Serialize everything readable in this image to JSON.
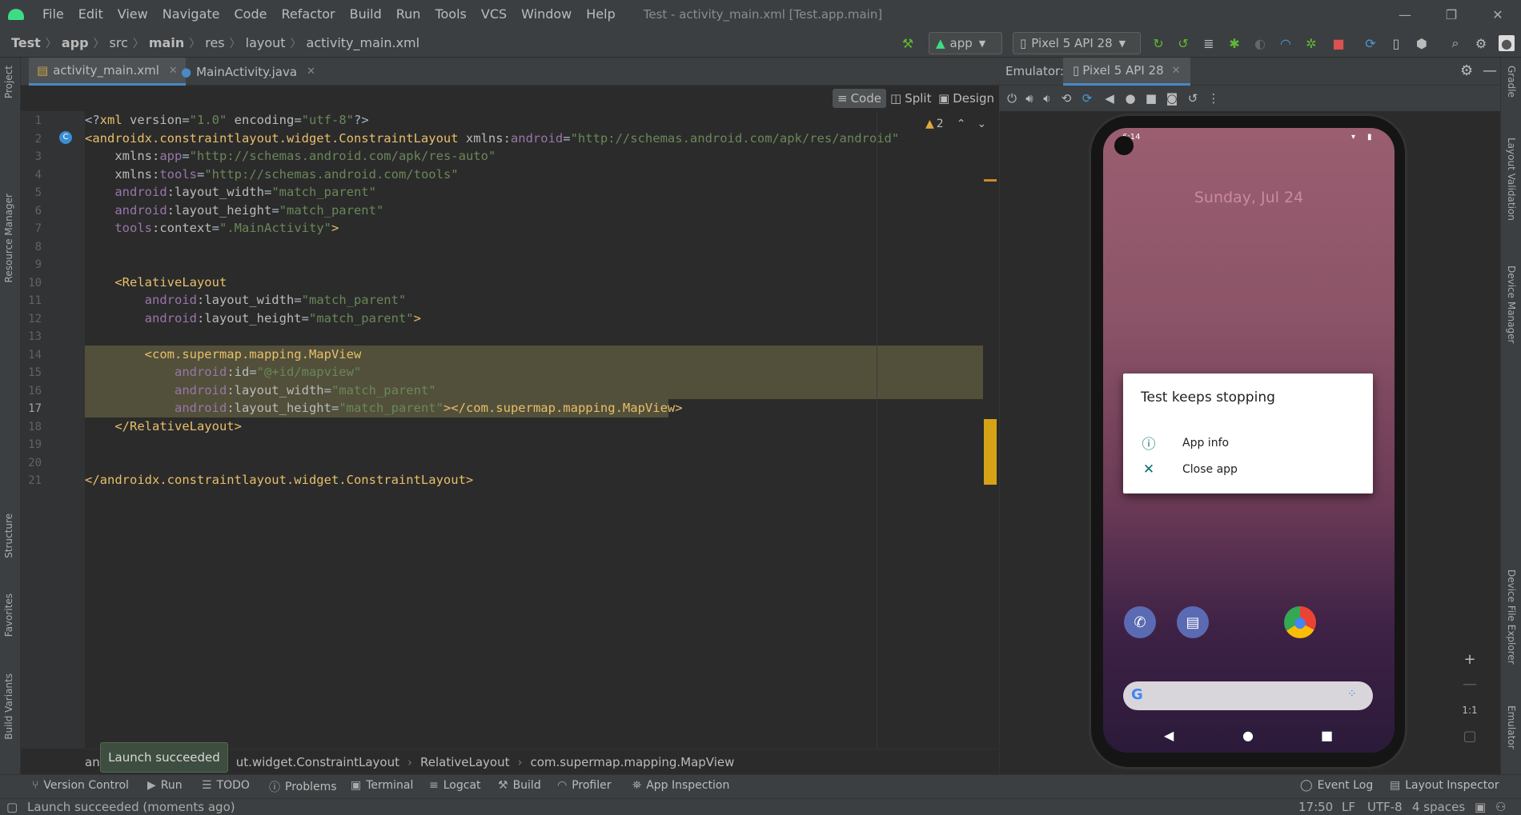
{
  "menu": {
    "items": [
      "File",
      "Edit",
      "View",
      "Navigate",
      "Code",
      "Refactor",
      "Build",
      "Run",
      "Tools",
      "VCS",
      "Window",
      "Help"
    ],
    "window_title": "Test - activity_main.xml [Test.app.main]"
  },
  "breadcrumb": {
    "items": [
      "Test",
      "app",
      "src",
      "main",
      "res",
      "layout",
      "activity_main.xml"
    ]
  },
  "toolbar": {
    "run_config": "app",
    "device": "Pixel 5 API 28"
  },
  "tabs": [
    {
      "label": "activity_main.xml"
    },
    {
      "label": "MainActivity.java"
    }
  ],
  "view_modes": {
    "code": "Code",
    "split": "Split",
    "design": "Design"
  },
  "inspections": {
    "warnings": "2"
  },
  "editor": {
    "lines": [
      [
        {
          "c": "p",
          "t": "<?"
        },
        {
          "c": "t",
          "t": "xml "
        },
        {
          "c": "a",
          "t": "version"
        },
        {
          "c": "p",
          "t": "="
        },
        {
          "c": "v",
          "t": "\"1.0\""
        },
        {
          "c": "a",
          "t": " encoding"
        },
        {
          "c": "p",
          "t": "="
        },
        {
          "c": "v",
          "t": "\"utf-8\""
        },
        {
          "c": "p",
          "t": "?>"
        }
      ],
      [
        {
          "c": "t",
          "t": "<androidx.constraintlayout.widget.ConstraintLayout "
        },
        {
          "c": "a",
          "t": "xmlns:"
        },
        {
          "c": "n",
          "t": "android"
        },
        {
          "c": "p",
          "t": "="
        },
        {
          "c": "v",
          "t": "\"http://schemas.android.com/apk/res/android\""
        }
      ],
      [
        {
          "c": "a",
          "t": "    xmlns:"
        },
        {
          "c": "n",
          "t": "app"
        },
        {
          "c": "p",
          "t": "="
        },
        {
          "c": "v",
          "t": "\"http://schemas.android.com/apk/res-auto\""
        }
      ],
      [
        {
          "c": "a",
          "t": "    xmlns:"
        },
        {
          "c": "n",
          "t": "tools"
        },
        {
          "c": "p",
          "t": "="
        },
        {
          "c": "v",
          "t": "\"http://schemas.android.com/tools\""
        }
      ],
      [
        {
          "c": "n",
          "t": "    android"
        },
        {
          "c": "a",
          "t": ":layout_width"
        },
        {
          "c": "p",
          "t": "="
        },
        {
          "c": "v",
          "t": "\"match_parent\""
        }
      ],
      [
        {
          "c": "n",
          "t": "    android"
        },
        {
          "c": "a",
          "t": ":layout_height"
        },
        {
          "c": "p",
          "t": "="
        },
        {
          "c": "v",
          "t": "\"match_parent\""
        }
      ],
      [
        {
          "c": "n",
          "t": "    tools"
        },
        {
          "c": "a",
          "t": ":context"
        },
        {
          "c": "p",
          "t": "="
        },
        {
          "c": "v",
          "t": "\".MainActivity\""
        },
        {
          "c": "t",
          "t": ">"
        }
      ],
      [],
      [],
      [
        {
          "c": "t",
          "t": "    <RelativeLayout"
        }
      ],
      [
        {
          "c": "n",
          "t": "        android"
        },
        {
          "c": "a",
          "t": ":layout_width"
        },
        {
          "c": "p",
          "t": "="
        },
        {
          "c": "v",
          "t": "\"match_parent\""
        }
      ],
      [
        {
          "c": "n",
          "t": "        android"
        },
        {
          "c": "a",
          "t": ":layout_height"
        },
        {
          "c": "p",
          "t": "="
        },
        {
          "c": "v",
          "t": "\"match_parent\""
        },
        {
          "c": "t",
          "t": ">"
        }
      ],
      [],
      [
        {
          "c": "t",
          "t": "        <com.supermap.mapping.MapView"
        }
      ],
      [
        {
          "c": "n",
          "t": "            android"
        },
        {
          "c": "a",
          "t": ":id"
        },
        {
          "c": "p",
          "t": "="
        },
        {
          "c": "v",
          "t": "\"@+id/mapview\""
        }
      ],
      [
        {
          "c": "n",
          "t": "            android"
        },
        {
          "c": "a",
          "t": ":layout_width"
        },
        {
          "c": "p",
          "t": "="
        },
        {
          "c": "v",
          "t": "\"match_parent\""
        }
      ],
      [
        {
          "c": "n",
          "t": "            android"
        },
        {
          "c": "a",
          "t": ":layout_height"
        },
        {
          "c": "p",
          "t": "="
        },
        {
          "c": "v",
          "t": "\"match_parent\""
        },
        {
          "c": "t",
          "t": "></com.supermap.mapping.MapView>"
        }
      ],
      [
        {
          "c": "t",
          "t": "    </RelativeLayout>"
        }
      ],
      [],
      [],
      [
        {
          "c": "t",
          "t": "</androidx.constraintlayout.widget.ConstraintLayout>"
        }
      ]
    ]
  },
  "editor_breadcrumb": {
    "items": [
      "ut.widget.ConstraintLayout",
      "RelativeLayout",
      "com.supermap.mapping.MapView"
    ]
  },
  "tooltip": {
    "text": "Launch succeeded"
  },
  "tool_windows": {
    "left": [
      "Version Control",
      "Run",
      "TODO",
      "Problems",
      "Terminal",
      "Logcat",
      "Build",
      "Profiler",
      "App Inspection"
    ],
    "right": [
      "Event Log",
      "Layout Inspector"
    ]
  },
  "side_left": [
    "Project",
    "Resource Manager",
    "Structure",
    "Favorites",
    "Build Variants"
  ],
  "side_right": [
    "Gradle",
    "Layout Validation",
    "Device Manager",
    "Device File Explorer",
    "Emulator"
  ],
  "status": {
    "message": "Launch succeeded (moments ago)",
    "position": "17:50",
    "line_sep": "LF",
    "encoding": "UTF-8",
    "indent": "4 spaces"
  },
  "emulator": {
    "label": "Emulator:",
    "device_tab": "Pixel 5 API 28",
    "zoom_1to1": "1:1"
  },
  "phone": {
    "time": "6:14",
    "date": "Sunday, Jul 24",
    "dialog": {
      "title": "Test keeps stopping",
      "app_info": "App info",
      "close_app": "Close app"
    }
  }
}
